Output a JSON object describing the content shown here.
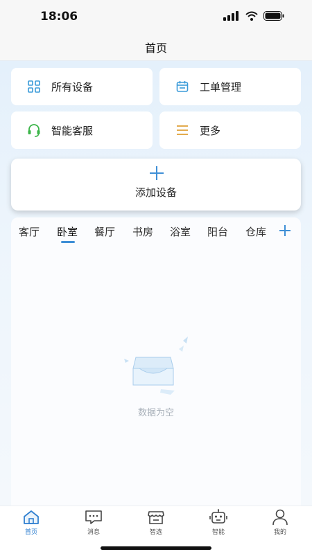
{
  "status": {
    "time": "18:06"
  },
  "header": {
    "title": "首页"
  },
  "quick_actions": [
    {
      "label": "所有设备",
      "icon": "grid-icon"
    },
    {
      "label": "工单管理",
      "icon": "calendar-icon"
    },
    {
      "label": "智能客服",
      "icon": "headset-icon"
    },
    {
      "label": "更多",
      "icon": "menu-icon"
    }
  ],
  "add_device": {
    "label": "添加设备",
    "icon": "plus-icon"
  },
  "rooms": {
    "tabs": [
      "客厅",
      "卧室",
      "餐厅",
      "书房",
      "浴室",
      "阳台",
      "仓库"
    ],
    "active_index": 1,
    "empty_text": "数据为空"
  },
  "bottom_nav": [
    {
      "label": "首页",
      "icon": "home-icon",
      "active": true
    },
    {
      "label": "消息",
      "icon": "message-icon",
      "active": false
    },
    {
      "label": "智选",
      "icon": "store-icon",
      "active": false
    },
    {
      "label": "智能",
      "icon": "robot-icon",
      "active": false
    },
    {
      "label": "我的",
      "icon": "user-icon",
      "active": false
    }
  ],
  "colors": {
    "accent": "#3f8fd6",
    "active_nav": "#2f7fd0",
    "icon_blue": "#3a9bd9",
    "icon_green": "#3cb54a",
    "icon_orange": "#e0a23a"
  }
}
